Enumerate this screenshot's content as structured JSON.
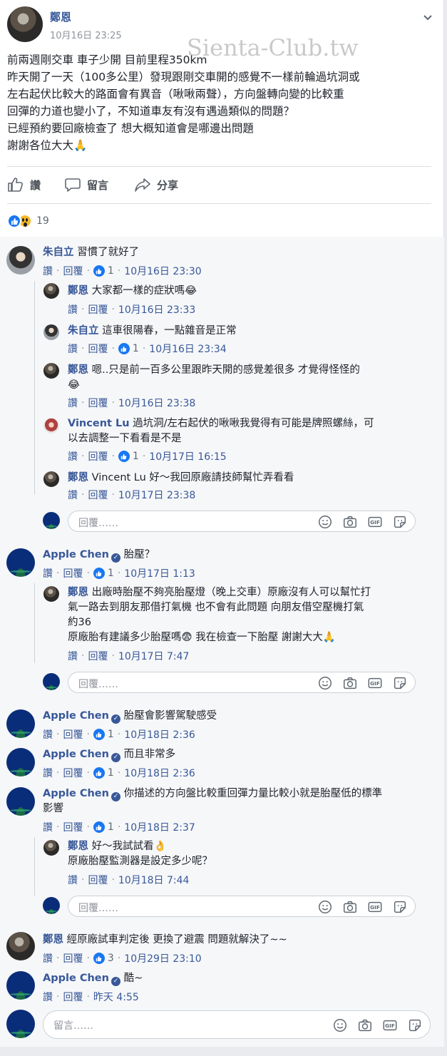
{
  "post": {
    "author": "鄭恩",
    "time": "10月16日 23:25",
    "watermark": "Sienta-Club.tw",
    "lines": [
      "前兩週剛交車 車子少開 目前里程350km",
      "昨天開了一天（100多公里）發現跟剛交車開的感覺不一樣前輪過坑洞或",
      "左右起伏比較大的路面會有異音（啾啾兩聲），方向盤轉向變的比較重",
      "回彈的力道也變小了，不知道車友有沒有遇過類似的問題？",
      "已經預約要回廠檢查了 想大概知道會是哪邊出問題",
      "謝謝各位大大🙏"
    ]
  },
  "actions": {
    "like": "讚",
    "comment": "留言",
    "share": "分享"
  },
  "reactions": {
    "count": "19",
    "types": [
      "like-icon",
      "wow-icon"
    ]
  },
  "labels": {
    "like": "讚",
    "reply": "回覆",
    "reply_placeholder": "回覆……",
    "comment_placeholder": "留言……"
  },
  "comments": [
    {
      "author": "朱自立",
      "text": "習慣了就好了",
      "likes": "1",
      "time": "10月16日 23:30",
      "replies": [
        {
          "author": "鄭恩",
          "text": "大家都一樣的症狀嗎😂",
          "likes": "",
          "time": "10月16日 23:33"
        },
        {
          "author": "朱自立",
          "text": "這車很陽春，一點雜音是正常",
          "likes": "1",
          "time": "10月16日 23:34"
        },
        {
          "author": "鄭恩",
          "text": "嗯..只是前一百多公里跟昨天開的感覺差很多 才覺得怪怪的",
          "text2": "😂",
          "likes": "",
          "time": "10月16日 23:38"
        },
        {
          "author": "Vincent Lu",
          "text": "過坑洞/左右起伏的啾啾我覺得有可能是牌照螺絲，可",
          "text2": "以去調整一下看看是不是",
          "likes": "1",
          "time": "10月17日 16:15"
        },
        {
          "author": "鄭恩",
          "text": "Vincent Lu 好～我回原廠請技師幫忙弄看看",
          "likes": "",
          "time": "10月17日 23:38"
        }
      ]
    },
    {
      "author": "Apple Chen",
      "text": "胎壓？",
      "likes": "1",
      "time": "10月17日 1:13",
      "replies": [
        {
          "author": "鄭恩",
          "text": "出廠時胎壓不夠亮胎壓燈（晚上交車）原廠沒有人可以幫忙打",
          "text2": "氣一路去到朋友那借打氣機 也不會有此問題 向朋友借空壓機打氣",
          "text3": "約36",
          "text4": "原廠胎有建議多少胎壓嗎😨 我在檢查一下胎壓 謝謝大大🙏",
          "likes": "",
          "time": "10月17日 7:47"
        }
      ]
    },
    {
      "author": "Apple Chen",
      "text": "胎壓會影響駕駛感受",
      "likes": "1",
      "time": "10月18日 2:36"
    },
    {
      "author": "Apple Chen",
      "text": "而且非常多",
      "likes": "1",
      "time": "10月18日 2:36"
    },
    {
      "author": "Apple Chen",
      "text": "你描述的方向盤比較重回彈力量比較小就是胎壓低的標準",
      "text2": "影響",
      "likes": "1",
      "time": "10月18日 2:37",
      "replies": [
        {
          "author": "鄭恩",
          "text": "好～我試試看👌",
          "text2": "原廠胎壓監測器是設定多少呢？",
          "likes": "",
          "time": "10月18日 7:44"
        }
      ]
    },
    {
      "author": "鄭恩",
      "text": "經原廠試車判定後 更換了避震 問題就解決了~~",
      "likes": "3",
      "time": "10月29日 23:10"
    },
    {
      "author": "Apple Chen",
      "text": "酷~",
      "likes": "",
      "time": "昨天 4:55"
    }
  ]
}
